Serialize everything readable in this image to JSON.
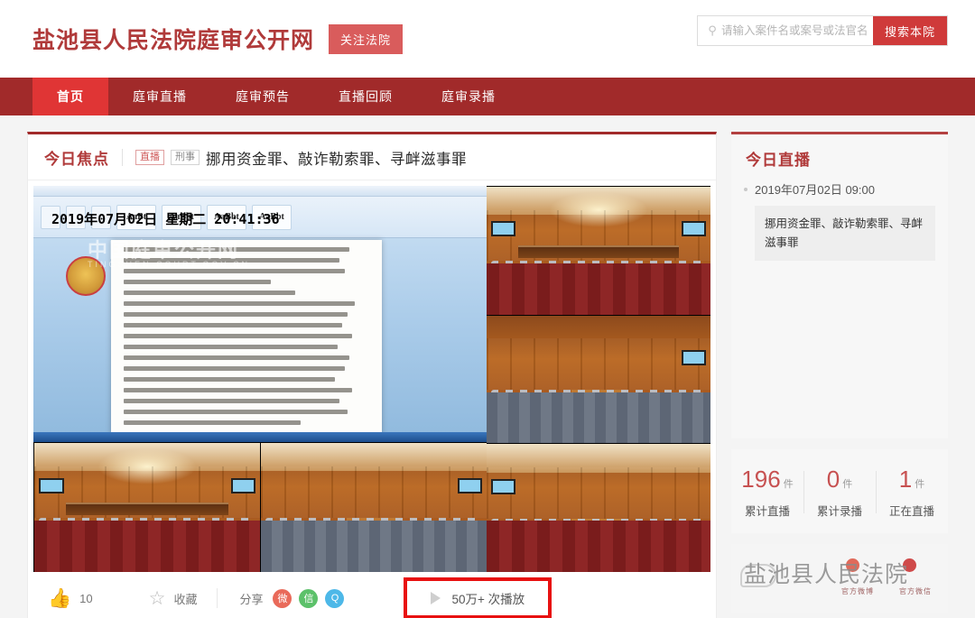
{
  "header": {
    "site_title": "盐池县人民法院庭审公开网",
    "follow_label": "关注法院",
    "search_placeholder": "请输入案件名或案号或法官名",
    "search_button": "搜索本院",
    "search_icon": "search-icon"
  },
  "nav": {
    "items": [
      {
        "label": "首页",
        "active": true
      },
      {
        "label": "庭审直播",
        "active": false
      },
      {
        "label": "庭审预告",
        "active": false
      },
      {
        "label": "直播回顾",
        "active": false
      },
      {
        "label": "庭审录播",
        "active": false
      }
    ]
  },
  "focus": {
    "section_label": "今日焦点",
    "tag_live": "直播",
    "tag_type": "刑事",
    "title": "挪用资金罪、敲诈勒索罪、寻衅滋事罪"
  },
  "video": {
    "timestamp_overlay": "2019年07月02日  星期二  20:41:36",
    "watermark": "中国庭审公开网",
    "watermark_sub": "TINGSHEN.COURT.GOV.CN",
    "ribbon_styles": [
      "AaBt",
      "AaBbt",
      "AaBbt",
      "AaBbt"
    ]
  },
  "actions": {
    "like_icon": "thumbs-up-icon",
    "like_count": "10",
    "favorite_icon": "star-icon",
    "favorite_label": "收藏",
    "share_label": "分享",
    "share_targets": [
      {
        "name": "weibo",
        "glyph": "微"
      },
      {
        "name": "wechat",
        "glyph": "信"
      },
      {
        "name": "qq",
        "glyph": "Q"
      }
    ],
    "play_icon": "play-triangle-icon",
    "play_count": "50万+ 次播放"
  },
  "sidebar": {
    "today_live_title": "今日直播",
    "live_items": [
      {
        "date": "2019年07月02日 09:00",
        "title": "挪用资金罪、敲诈勒索罪、寻衅滋事罪"
      }
    ],
    "stats": [
      {
        "value": "196",
        "unit": "件",
        "label": "累计直播"
      },
      {
        "value": "0",
        "unit": "件",
        "label": "累计录播"
      },
      {
        "value": "1",
        "unit": "件",
        "label": "正在直播"
      }
    ],
    "qr": {
      "court_name": "盐池县人民法院",
      "weibo_label": "官方微博",
      "wechat_label": "官方微信"
    }
  },
  "colors": {
    "brand_red": "#a12a2a",
    "active_red": "#e03535",
    "accent_red": "#cf3a3a",
    "highlight_border": "#e81010"
  }
}
